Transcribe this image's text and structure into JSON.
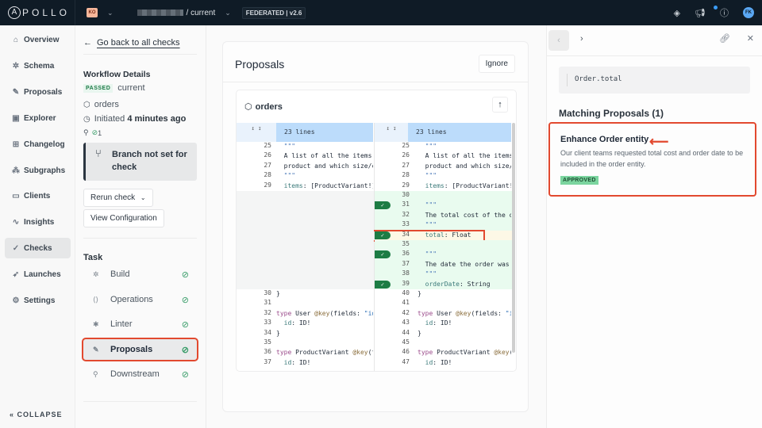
{
  "topbar": {
    "logo": "APOLLO",
    "org_initials": "KO",
    "graph_variant": "/ current",
    "federation_badge": "FEDERATED | v2.6",
    "user_initials": "FK",
    "icons": [
      "layers-icon",
      "megaphone-icon",
      "help-icon"
    ]
  },
  "sidebar": {
    "items": [
      {
        "label": "Overview",
        "icon": "overview-icon"
      },
      {
        "label": "Schema",
        "icon": "schema-icon"
      },
      {
        "label": "Proposals",
        "icon": "proposals-icon"
      },
      {
        "label": "Explorer",
        "icon": "explorer-icon"
      },
      {
        "label": "Changelog",
        "icon": "changelog-icon"
      },
      {
        "label": "Subgraphs",
        "icon": "subgraphs-icon"
      },
      {
        "label": "Clients",
        "icon": "clients-icon"
      },
      {
        "label": "Insights",
        "icon": "insights-icon"
      },
      {
        "label": "Checks",
        "icon": "checks-icon",
        "active": true
      },
      {
        "label": "Launches",
        "icon": "launches-icon"
      },
      {
        "label": "Settings",
        "icon": "settings-icon"
      }
    ],
    "collapse": "COLLAPSE"
  },
  "details": {
    "back": "Go back to all checks",
    "workflow_title": "Workflow Details",
    "status": "PASSED",
    "variant": "current",
    "subgraph": "orders",
    "initiated_prefix": "Initiated",
    "initiated_time": "4 minutes ago",
    "passed_count": "1",
    "branch_notice": "Branch not set for check",
    "rerun": "Rerun check",
    "view_config": "View Configuration",
    "task_title": "Task",
    "tasks": [
      {
        "label": "Build",
        "icon": "build-icon"
      },
      {
        "label": "Operations",
        "icon": "operations-icon"
      },
      {
        "label": "Linter",
        "icon": "linter-icon"
      },
      {
        "label": "Proposals",
        "icon": "proposals-icon",
        "selected": true
      },
      {
        "label": "Downstream",
        "icon": "downstream-icon"
      }
    ]
  },
  "main": {
    "title": "Proposals",
    "ignore": "Ignore",
    "subgraph": "orders",
    "hunk": "23 lines",
    "left_lines": [
      {
        "n": "25",
        "t": "  \"\"\""
      },
      {
        "n": "26",
        "t": "  A list of all the items"
      },
      {
        "n": "27",
        "t": "  product and which size/c"
      },
      {
        "n": "28",
        "t": "  \"\"\""
      },
      {
        "n": "29",
        "t": "  items: [ProductVariant!]"
      },
      {
        "n": "30",
        "t": "}"
      },
      {
        "n": "31",
        "t": ""
      },
      {
        "n": "32",
        "t": "type User @key(fields: \"id"
      },
      {
        "n": "33",
        "t": "  id: ID!"
      },
      {
        "n": "34",
        "t": "}"
      },
      {
        "n": "35",
        "t": ""
      },
      {
        "n": "36",
        "t": "type ProductVariant @key(f"
      },
      {
        "n": "37",
        "t": "  id: ID!"
      }
    ],
    "right_lines": [
      {
        "n": "25",
        "t": "  \"\"\""
      },
      {
        "n": "26",
        "t": "  A list of all the items"
      },
      {
        "n": "27",
        "t": "  product and which size/c"
      },
      {
        "n": "28",
        "t": "  \"\"\""
      },
      {
        "n": "29",
        "t": "  items: [ProductVariant!]"
      },
      {
        "n": "30",
        "t": "",
        "added": true
      },
      {
        "n": "31",
        "t": "  \"\"\"",
        "added": true,
        "check": true
      },
      {
        "n": "32",
        "t": "  The total cost of the or",
        "added": true
      },
      {
        "n": "33",
        "t": "  \"\"\"",
        "added": true
      },
      {
        "n": "34",
        "t": "  total: Float",
        "added": true,
        "check": true,
        "highlight": true
      },
      {
        "n": "35",
        "t": "",
        "added": true
      },
      {
        "n": "36",
        "t": "  \"\"\"",
        "added": true,
        "check": true
      },
      {
        "n": "37",
        "t": "  The date the order was m",
        "added": true
      },
      {
        "n": "38",
        "t": "  \"\"\"",
        "added": true
      },
      {
        "n": "39",
        "t": "  orderDate: String",
        "added": true,
        "check": true
      },
      {
        "n": "40",
        "t": "}"
      },
      {
        "n": "41",
        "t": ""
      },
      {
        "n": "42",
        "t": "type User @key(fields: \"id"
      },
      {
        "n": "43",
        "t": "  id: ID!"
      },
      {
        "n": "44",
        "t": "}"
      },
      {
        "n": "45",
        "t": ""
      },
      {
        "n": "46",
        "t": "type ProductVariant @key(f"
      },
      {
        "n": "47",
        "t": "  id: ID!"
      }
    ]
  },
  "panel": {
    "coordinate": "Order.total",
    "matching_title": "Matching Proposals (1)",
    "proposal_title": "Enhance Order entity",
    "proposal_desc": "Our client teams requested total cost and order date to be included in the order entity.",
    "proposal_status": "APPROVED"
  }
}
